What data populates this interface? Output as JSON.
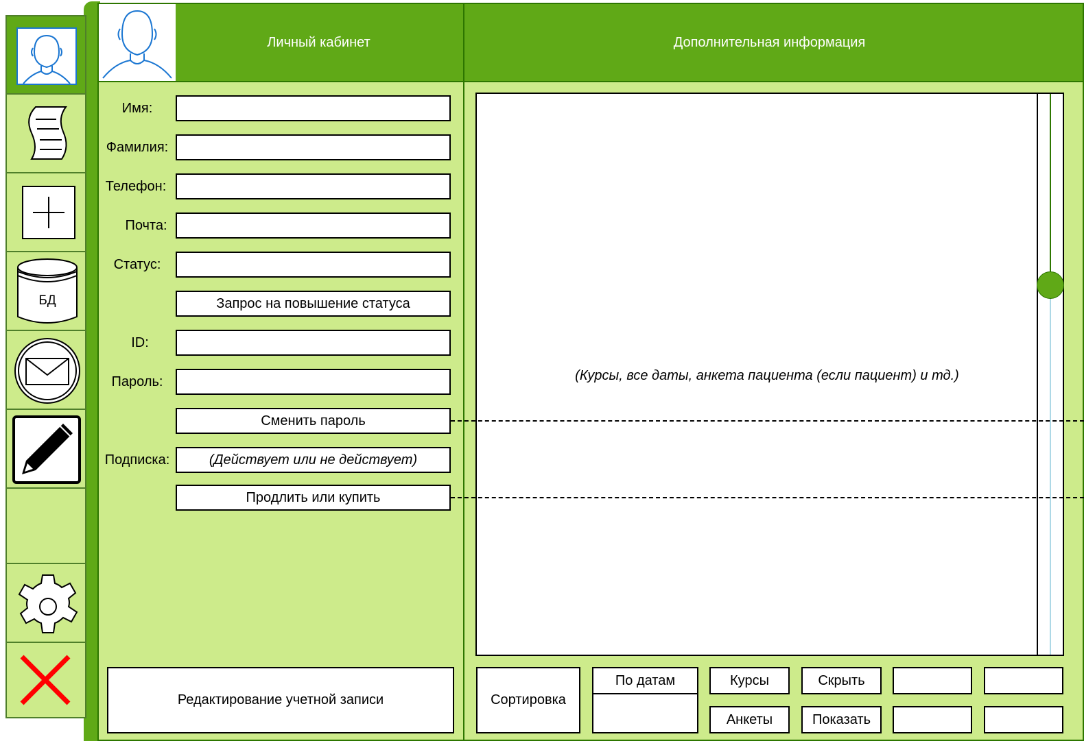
{
  "colors": {
    "accent": "#60a917",
    "panel": "#cdeb8b",
    "border": "#2d7600",
    "close": "#ff0000"
  },
  "sidebar": {
    "items": [
      {
        "name": "profile",
        "icon": "user-icon"
      },
      {
        "name": "documents",
        "icon": "scroll-icon"
      },
      {
        "name": "add",
        "icon": "plus-icon"
      },
      {
        "name": "database",
        "icon": "database-icon",
        "label": "БД"
      },
      {
        "name": "messages",
        "icon": "envelope-icon"
      },
      {
        "name": "edit",
        "icon": "pencil-icon"
      },
      {
        "name": "empty",
        "icon": ""
      },
      {
        "name": "settings",
        "icon": "gear-icon"
      },
      {
        "name": "close",
        "icon": "close-icon"
      }
    ]
  },
  "header": {
    "profile_title": "Личный кабинет",
    "info_title": "Дополнительная информация"
  },
  "form": {
    "name_label": "Имя:",
    "surname_label": "Фамилия:",
    "phone_label": "Телефон:",
    "email_label": "Почта:",
    "status_label": "Статус:",
    "status_request_button": "Запрос на повышение статуса",
    "id_label": "ID:",
    "password_label": "Пароль:",
    "change_password_button": "Сменить пароль",
    "subscription_label": "Подписка:",
    "subscription_value": "(Действует или не действует)",
    "renew_button": "Продлить или купить",
    "edit_account_button": "Редактирование учетной записи"
  },
  "info": {
    "placeholder_text": "(Курсы, все даты, анкета пациента (если пациент) и тд.)",
    "scroll_position": 0.33
  },
  "toolbar": {
    "sort_label": "Сортировка",
    "by_dates_label": "По датам",
    "courses_label": "Курсы",
    "hide_label": "Скрыть",
    "questionnaires_label": "Анкеты",
    "show_label": "Показать"
  }
}
